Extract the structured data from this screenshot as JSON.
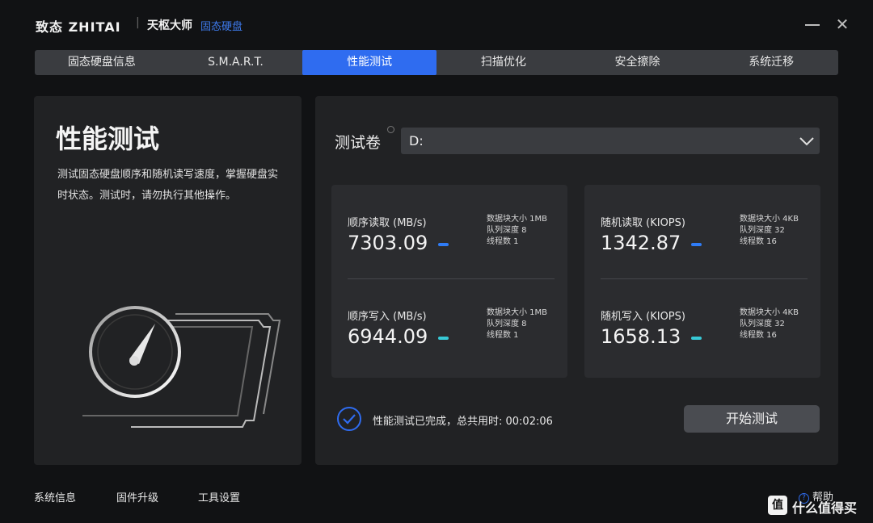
{
  "titlebar": {
    "brand": "致态 ZHITAI",
    "separator": "|",
    "product": "天枢大师",
    "product_sub": "固态硬盘",
    "close_glyph": "✕"
  },
  "tabs": [
    {
      "label": "固态硬盘信息",
      "active": false
    },
    {
      "label": "S.M.A.R.T.",
      "active": false
    },
    {
      "label": "性能测试",
      "active": true
    },
    {
      "label": "扫描优化",
      "active": false
    },
    {
      "label": "安全擦除",
      "active": false
    },
    {
      "label": "系统迁移",
      "active": false
    }
  ],
  "left": {
    "title": "性能测试",
    "description": "测试固态硬盘顺序和随机读写速度，掌握硬盘实时状态。测试时，请勿执行其他操作。"
  },
  "volume": {
    "label": "测试卷",
    "value": "D:"
  },
  "cards": [
    {
      "metrics": [
        {
          "label": "顺序读取 (MB/s)",
          "value": "7303.09",
          "color": "#2f7cf6",
          "params": [
            "数据块大小 1MB",
            "队列深度 8",
            "线程数 1"
          ]
        },
        {
          "label": "顺序写入 (MB/s)",
          "value": "6944.09",
          "color": "#37c9d6",
          "params": [
            "数据块大小 1MB",
            "队列深度 8",
            "线程数 1"
          ]
        }
      ]
    },
    {
      "metrics": [
        {
          "label": "随机读取 (KIOPS)",
          "value": "1342.87",
          "color": "#2f7cf6",
          "params": [
            "数据块大小 4KB",
            "队列深度 32",
            "线程数 16"
          ]
        },
        {
          "label": "随机写入 (KIOPS)",
          "value": "1658.13",
          "color": "#37c9d6",
          "params": [
            "数据块大小 4KB",
            "队列深度 32",
            "线程数 16"
          ]
        }
      ]
    }
  ],
  "status": {
    "text": "性能测试已完成，总共用时: 00:02:06"
  },
  "start_button": "开始测试",
  "footer": {
    "links": [
      "系统信息",
      "固件升级",
      "工具设置"
    ],
    "help": "帮助",
    "help_glyph": "?"
  },
  "watermark": {
    "logo": "值",
    "text": "什么值得买"
  },
  "colors": {
    "accent": "#2f6cf0",
    "read_dash": "#2f7cf6",
    "write_dash": "#37c9d6"
  }
}
